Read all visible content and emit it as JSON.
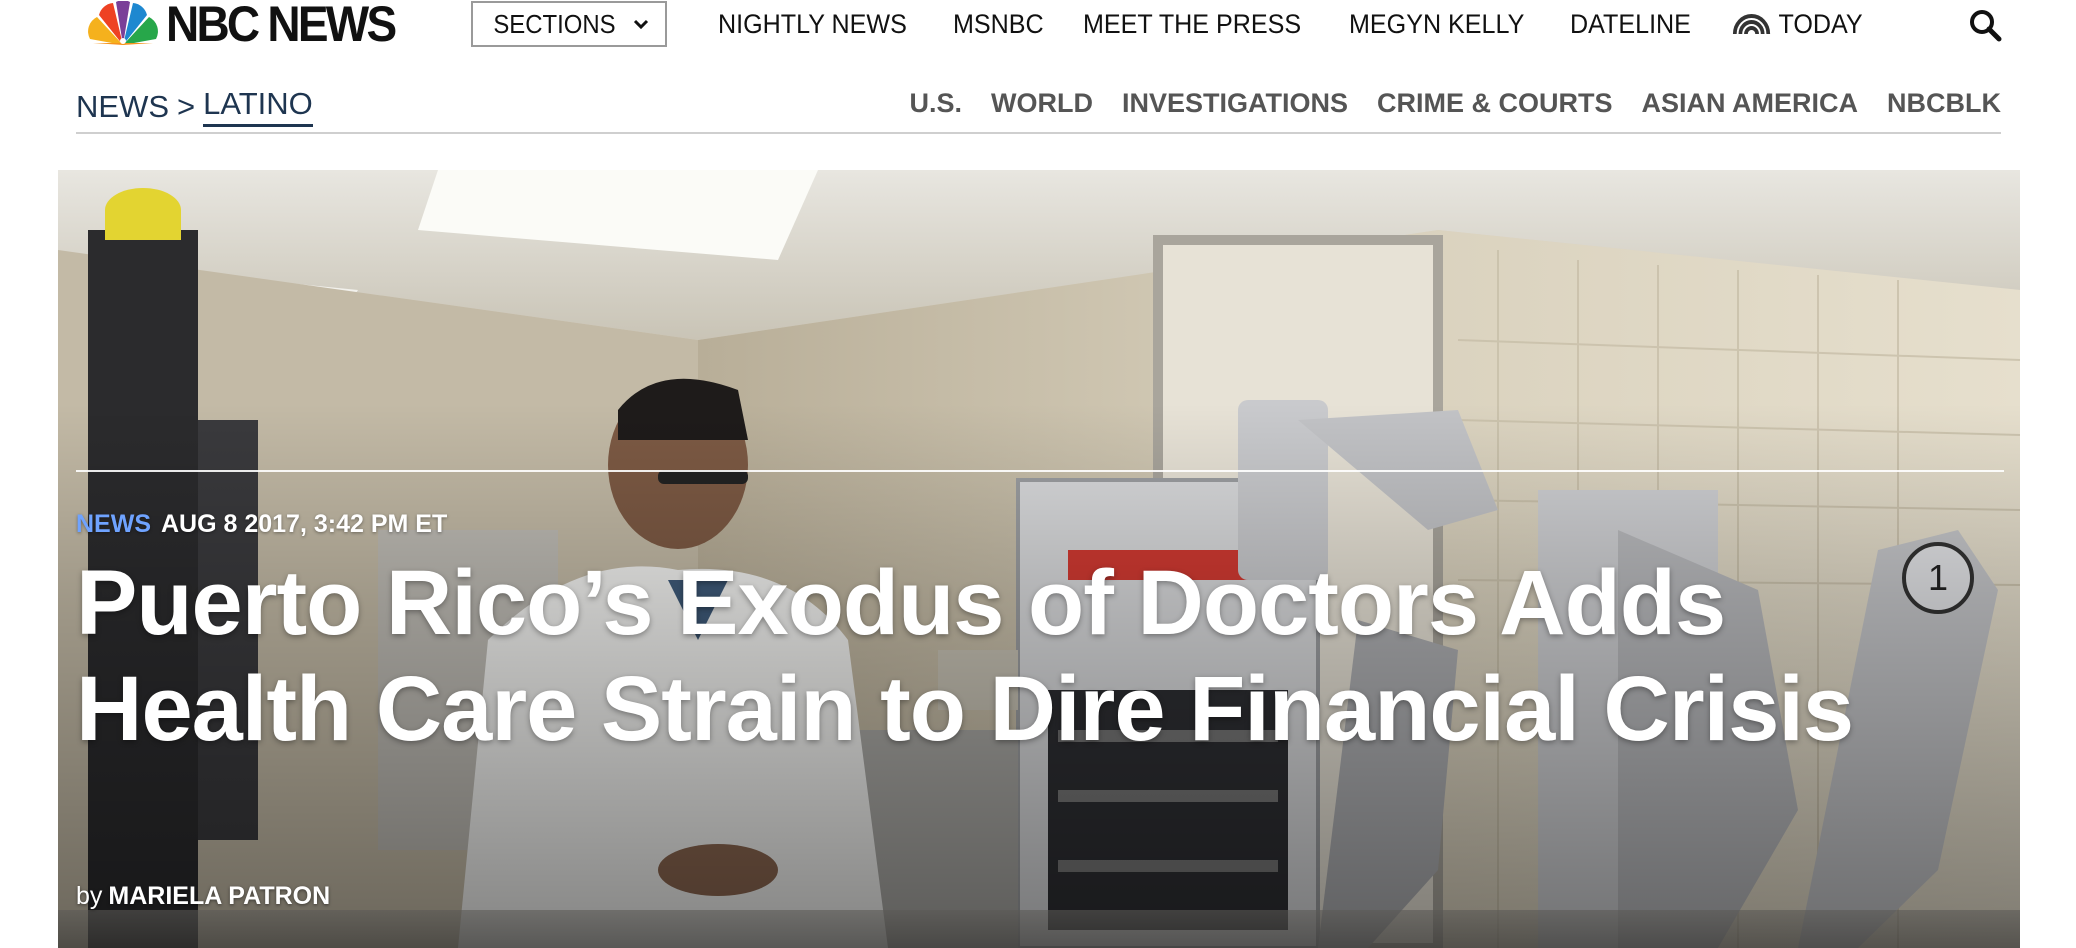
{
  "header": {
    "logo_text": "NBC NEWS",
    "sections_label": "SECTIONS",
    "nav": [
      {
        "label": "NIGHTLY NEWS"
      },
      {
        "label": "MSNBC"
      },
      {
        "label": "MEET THE PRESS"
      },
      {
        "label": "MEGYN KELLY"
      },
      {
        "label": "DATELINE"
      },
      {
        "label": "TODAY",
        "icon": "today-rainbow-icon"
      }
    ],
    "search_icon": "search-icon"
  },
  "subnav": {
    "breadcrumb": {
      "root": "NEWS",
      "separator": ">",
      "current": "LATINO"
    },
    "categories": [
      "U.S.",
      "WORLD",
      "INVESTIGATIONS",
      "CRIME & COURTS",
      "ASIAN AMERICA",
      "NBCBLK"
    ]
  },
  "article": {
    "label": "NEWS",
    "timestamp": "AUG 8 2017, 3:42 PM ET",
    "headline": "Puerto Rico’s Exodus of Doctors Adds Health Care Strain to Dire Financial Crisis",
    "byline_prefix": "by",
    "author": "MARIELA PATRON"
  },
  "colors": {
    "label_blue": "#6fa3ff",
    "breadcrumb_navy": "#1e3550",
    "category_gray": "#555555"
  }
}
